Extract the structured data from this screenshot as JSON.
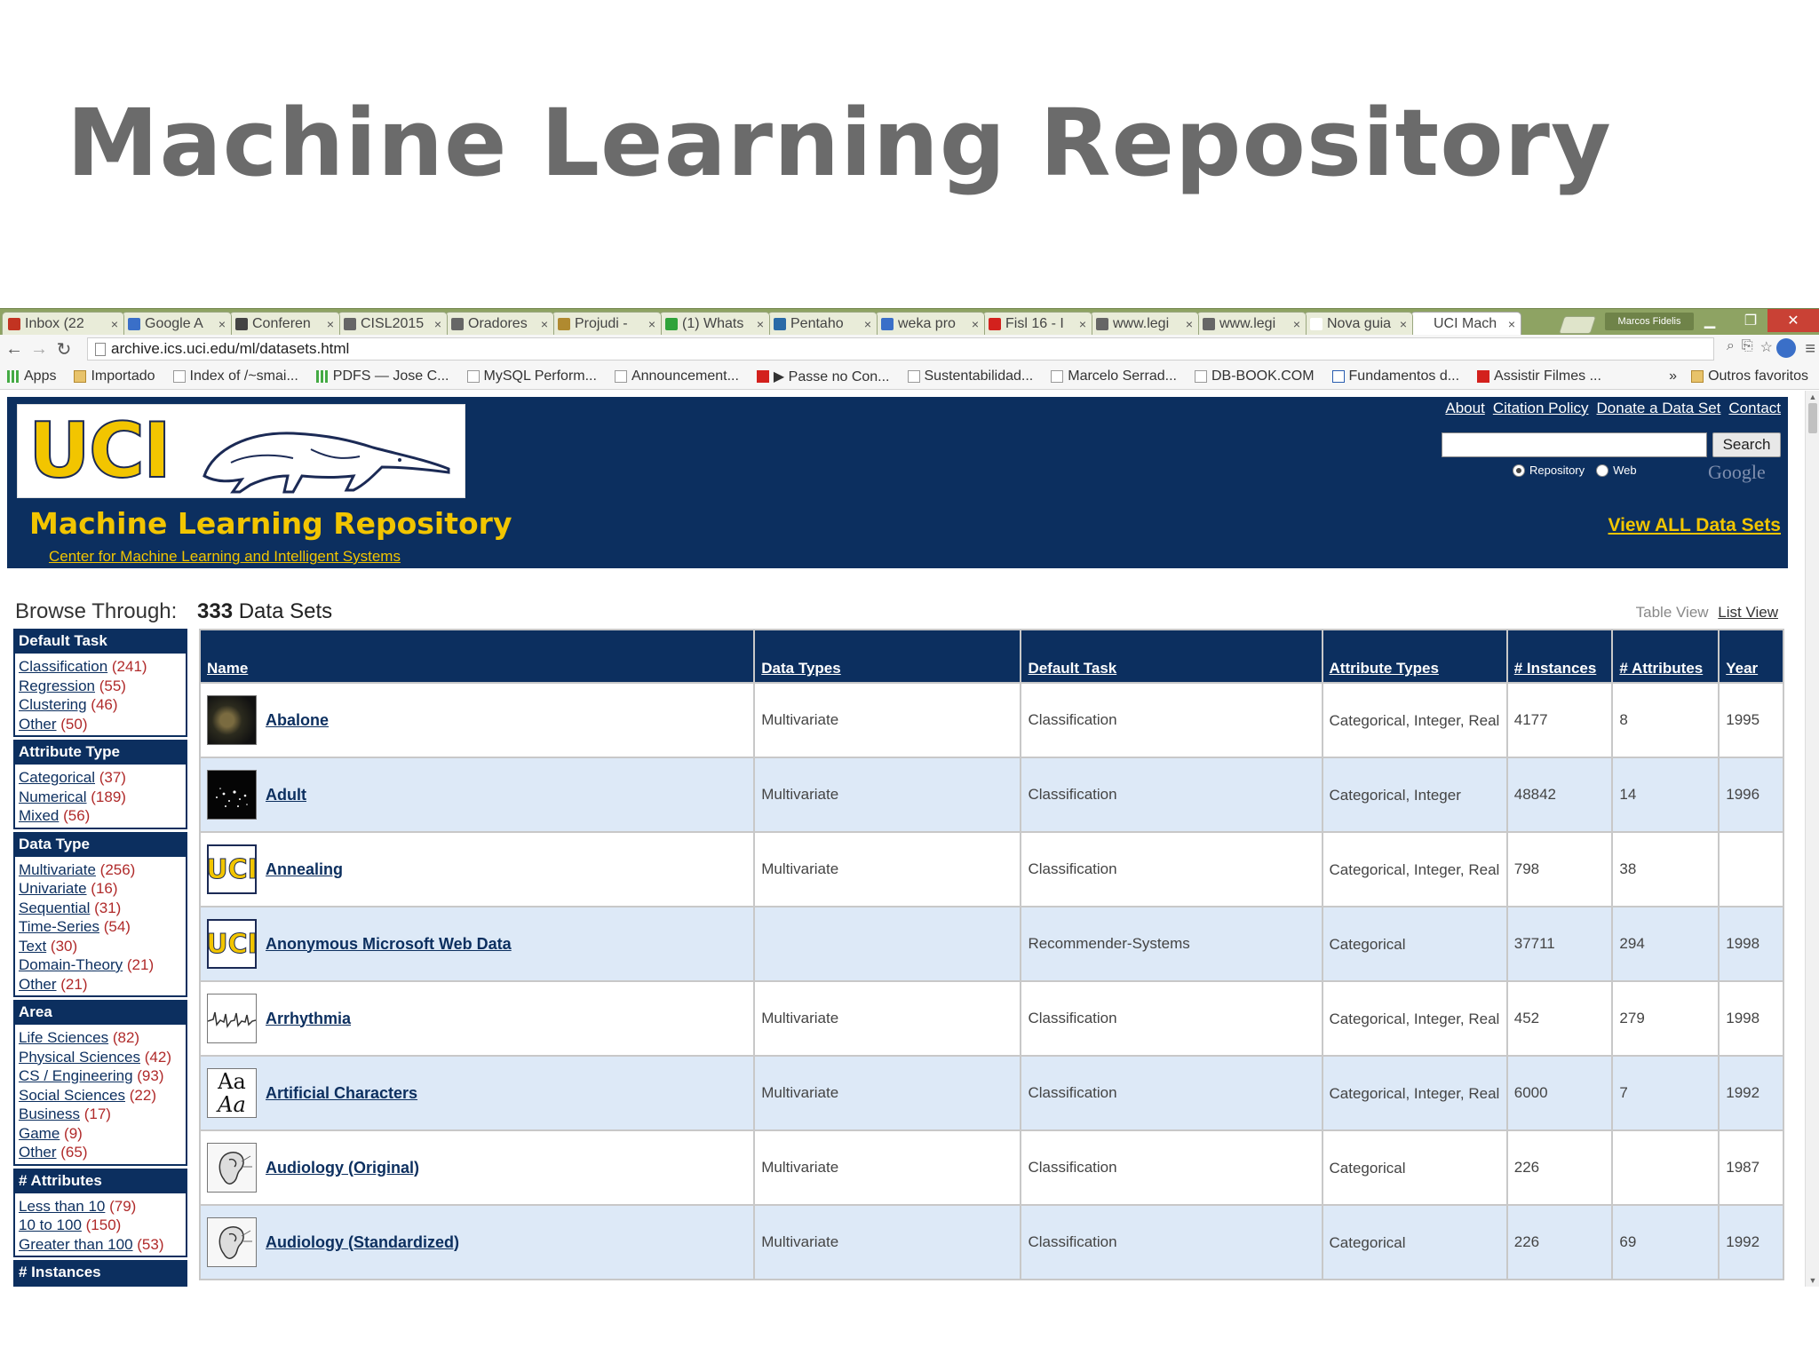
{
  "slide": {
    "title": "Machine Learning Repository"
  },
  "browser": {
    "tabs": [
      {
        "label": "Inbox (22",
        "icon": "gmail-icon",
        "color": "#c23321"
      },
      {
        "label": "Google A",
        "icon": "google-analytics-icon",
        "color": "#3a6fc8"
      },
      {
        "label": "Conferen",
        "icon": "document-icon",
        "color": "#444444"
      },
      {
        "label": "CISL2015",
        "icon": "globe-icon",
        "color": "#666666"
      },
      {
        "label": "Oradores",
        "icon": "globe-icon",
        "color": "#666666"
      },
      {
        "label": "Projudi -",
        "icon": "scales-icon",
        "color": "#b08a30"
      },
      {
        "label": "(1) Whats",
        "icon": "whatsapp-icon",
        "color": "#2fa33a"
      },
      {
        "label": "Pentaho",
        "icon": "wordpress-icon",
        "color": "#2a6aa7"
      },
      {
        "label": "weka pro",
        "icon": "google-icon",
        "color": "#3a6fc8"
      },
      {
        "label": "Fisl 16 - I",
        "icon": "youtube-icon",
        "color": "#d3211d"
      },
      {
        "label": "www.legi",
        "icon": "globe-icon",
        "color": "#666666"
      },
      {
        "label": "www.legi",
        "icon": "globe-icon",
        "color": "#666666"
      },
      {
        "label": "Nova guia",
        "icon": "blank-icon",
        "color": "#ffffff"
      },
      {
        "label": "UCI Mach",
        "icon": "page-icon",
        "color": "#ffffff"
      }
    ],
    "profile_name": "Marcos Fidelis",
    "url": "archive.ics.uci.edu/ml/datasets.html",
    "bookmarks": [
      {
        "label": "Apps",
        "icon": "grid"
      },
      {
        "label": "Importado",
        "icon": "folder"
      },
      {
        "label": "Index of /~smai...",
        "icon": "page"
      },
      {
        "label": "PDFS — Jose C...",
        "icon": "grid"
      },
      {
        "label": "MySQL Perform...",
        "icon": "page"
      },
      {
        "label": "Announcement...",
        "icon": "page"
      },
      {
        "label": "▶ Passe no Con...",
        "icon": "red"
      },
      {
        "label": "Sustentabilidad...",
        "icon": "page"
      },
      {
        "label": "Marcelo Serrad...",
        "icon": "page"
      },
      {
        "label": "DB-BOOK.COM",
        "icon": "page"
      },
      {
        "label": "Fundamentos d...",
        "icon": "blue"
      },
      {
        "label": "Assistir Filmes ...",
        "icon": "red"
      }
    ],
    "bookmarks_more": "»",
    "other_bookmarks": "Outros favoritos"
  },
  "header": {
    "logo_text": "UCI",
    "repo_title": "Machine Learning Repository",
    "repo_subtitle": "Center for Machine Learning and Intelligent Systems",
    "links": [
      "About",
      "Citation Policy",
      "Donate a Data Set",
      "Contact"
    ],
    "search_button": "Search",
    "search_value": "",
    "radio_repository": "Repository",
    "radio_web": "Web",
    "google_label": "Google",
    "view_all": "View ALL Data Sets"
  },
  "browse": {
    "label": "Browse Through:",
    "count_number": "333",
    "count_label": "Data Sets",
    "table_view": "Table View",
    "list_view": "List View"
  },
  "sidebar": [
    {
      "heading": "Default Task",
      "items": [
        {
          "label": "Classification",
          "count": "(241)"
        },
        {
          "label": "Regression",
          "count": "(55)"
        },
        {
          "label": "Clustering",
          "count": "(46)"
        },
        {
          "label": "Other",
          "count": "(50)"
        }
      ]
    },
    {
      "heading": "Attribute Type",
      "items": [
        {
          "label": "Categorical",
          "count": "(37)"
        },
        {
          "label": "Numerical",
          "count": "(189)"
        },
        {
          "label": "Mixed",
          "count": "(56)"
        }
      ]
    },
    {
      "heading": "Data Type",
      "items": [
        {
          "label": "Multivariate",
          "count": "(256)"
        },
        {
          "label": "Univariate",
          "count": "(16)"
        },
        {
          "label": "Sequential",
          "count": "(31)"
        },
        {
          "label": "Time-Series",
          "count": "(54)"
        },
        {
          "label": "Text",
          "count": "(30)"
        },
        {
          "label": "Domain-Theory",
          "count": "(21)"
        },
        {
          "label": "Other",
          "count": "(21)"
        }
      ]
    },
    {
      "heading": "Area",
      "items": [
        {
          "label": "Life Sciences",
          "count": "(82)"
        },
        {
          "label": "Physical Sciences",
          "count": "(42)"
        },
        {
          "label": "CS / Engineering",
          "count": "(93)"
        },
        {
          "label": "Social Sciences",
          "count": "(22)"
        },
        {
          "label": "Business",
          "count": "(17)"
        },
        {
          "label": "Game",
          "count": "(9)"
        },
        {
          "label": "Other",
          "count": "(65)"
        }
      ]
    },
    {
      "heading": "# Attributes",
      "items": [
        {
          "label": "Less than 10",
          "count": "(79)"
        },
        {
          "label": "10 to 100",
          "count": "(150)"
        },
        {
          "label": "Greater than 100",
          "count": "(53)"
        }
      ]
    },
    {
      "heading": "# Instances",
      "items": []
    }
  ],
  "table": {
    "columns": [
      "Name",
      "Data Types",
      "Default Task",
      "Attribute Types",
      "# Instances",
      "# Attributes",
      "Year"
    ],
    "rows": [
      {
        "name": "Abalone",
        "thumb": "dark",
        "data_types": "Multivariate",
        "task": "Classification",
        "attr_types": "Categorical, Integer, Real",
        "instances": "4177",
        "attributes": "8",
        "year": "1995"
      },
      {
        "name": "Adult",
        "thumb": "stars",
        "data_types": "Multivariate",
        "task": "Classification",
        "attr_types": "Categorical, Integer",
        "instances": "48842",
        "attributes": "14",
        "year": "1996"
      },
      {
        "name": "Annealing",
        "thumb": "uci",
        "data_types": "Multivariate",
        "task": "Classification",
        "attr_types": "Categorical, Integer, Real",
        "instances": "798",
        "attributes": "38",
        "year": ""
      },
      {
        "name": "Anonymous Microsoft Web Data",
        "thumb": "uci",
        "data_types": "",
        "task": "Recommender-Systems",
        "attr_types": "Categorical",
        "instances": "37711",
        "attributes": "294",
        "year": "1998"
      },
      {
        "name": "Arrhythmia",
        "thumb": "wave",
        "data_types": "Multivariate",
        "task": "Classification",
        "attr_types": "Categorical, Integer, Real",
        "instances": "452",
        "attributes": "279",
        "year": "1998"
      },
      {
        "name": "Artificial Characters",
        "thumb": "chars",
        "data_types": "Multivariate",
        "task": "Classification",
        "attr_types": "Categorical, Integer, Real",
        "instances": "6000",
        "attributes": "7",
        "year": "1992"
      },
      {
        "name": "Audiology (Original)",
        "thumb": "ear",
        "data_types": "Multivariate",
        "task": "Classification",
        "attr_types": "Categorical",
        "instances": "226",
        "attributes": "",
        "year": "1987"
      },
      {
        "name": "Audiology (Standardized)",
        "thumb": "ear",
        "data_types": "Multivariate",
        "task": "Classification",
        "attr_types": "Categorical",
        "instances": "226",
        "attributes": "69",
        "year": "1992"
      }
    ]
  },
  "thumb_texts": {
    "uci": "UCI",
    "chars_top": "Aa",
    "chars_bottom": "Aa"
  }
}
